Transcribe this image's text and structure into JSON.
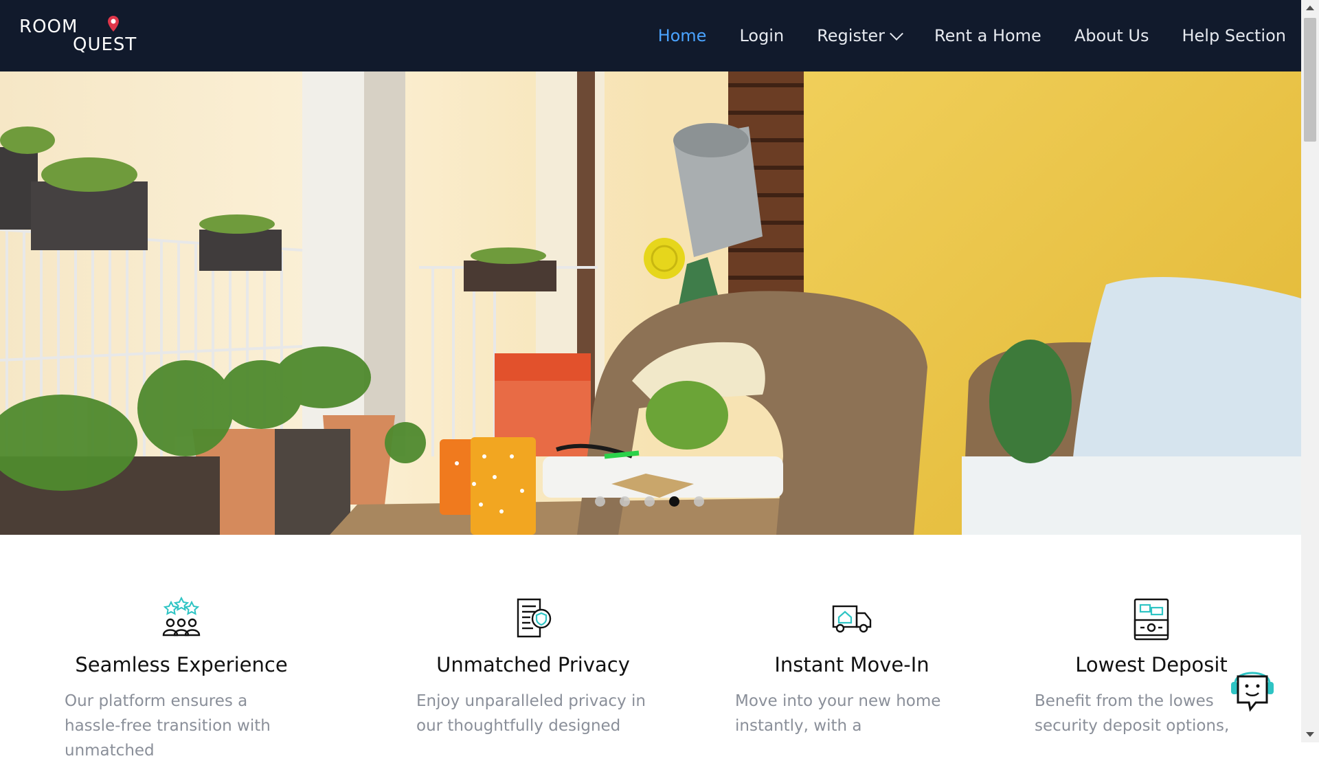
{
  "brand": {
    "line1": "ROOM",
    "line2": "QUEST"
  },
  "nav": {
    "items": [
      {
        "label": "Home",
        "active": true
      },
      {
        "label": "Login"
      },
      {
        "label": "Register",
        "dropdown": true
      },
      {
        "label": "Rent a Home"
      },
      {
        "label": "About Us"
      },
      {
        "label": "Help Section"
      }
    ]
  },
  "hero": {
    "slides": 5,
    "active_slide": 4
  },
  "features": [
    {
      "icon": "community-stars-icon",
      "title": "Seamless Experience",
      "text": "Our platform ensures a hassle-free transition with unmatched"
    },
    {
      "icon": "privacy-document-icon",
      "title": "Unmatched Privacy",
      "text": "Enjoy unparalleled privacy in our thoughtfully designed"
    },
    {
      "icon": "moving-truck-icon",
      "title": "Instant Move-In",
      "text": "Move into your new home instantly, with a"
    },
    {
      "icon": "deposit-money-icon",
      "title": "Lowest Deposit",
      "text": "Benefit from the lowes security deposit options,"
    }
  ],
  "colors": {
    "nav_bg": "#111a2c",
    "accent": "#4aa3ff",
    "icon_teal": "#2ec4c4"
  }
}
